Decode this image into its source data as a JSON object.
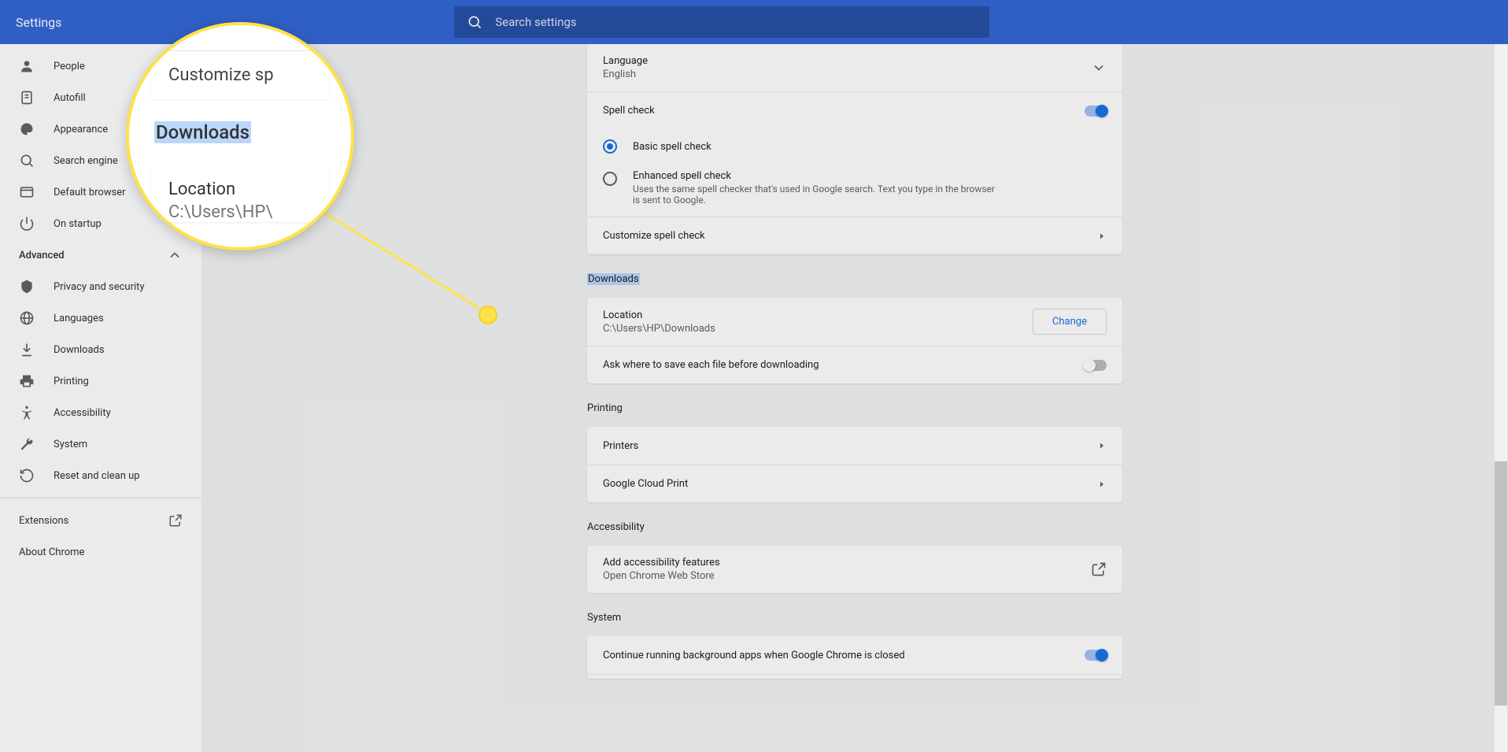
{
  "header": {
    "title": "Settings",
    "search_placeholder": "Search settings"
  },
  "sidebar": {
    "items": [
      {
        "label": "People"
      },
      {
        "label": "Autofill"
      },
      {
        "label": "Appearance"
      },
      {
        "label": "Search engine"
      },
      {
        "label": "Default browser"
      },
      {
        "label": "On startup"
      }
    ],
    "advanced_label": "Advanced",
    "advanced_items": [
      {
        "label": "Privacy and security"
      },
      {
        "label": "Languages"
      },
      {
        "label": "Downloads"
      },
      {
        "label": "Printing"
      },
      {
        "label": "Accessibility"
      },
      {
        "label": "System"
      },
      {
        "label": "Reset and clean up"
      }
    ],
    "extensions_label": "Extensions",
    "about_label": "About Chrome"
  },
  "languages": {
    "language_label": "Language",
    "language_value": "English",
    "spellcheck_label": "Spell check",
    "basic_label": "Basic spell check",
    "enhanced_label": "Enhanced spell check",
    "enhanced_desc": "Uses the same spell checker that's used in Google search. Text you type in the browser is sent to Google.",
    "customize_label": "Customize spell check"
  },
  "downloads": {
    "section_title": "Downloads",
    "location_label": "Location",
    "location_value": "C:\\Users\\HP\\Downloads",
    "change_label": "Change",
    "ask_label": "Ask where to save each file before downloading"
  },
  "printing": {
    "section_title": "Printing",
    "printers_label": "Printers",
    "cloud_label": "Google Cloud Print"
  },
  "accessibility": {
    "section_title": "Accessibility",
    "add_label": "Add accessibility features",
    "add_sub": "Open Chrome Web Store"
  },
  "system": {
    "section_title": "System",
    "bg_label": "Continue running background apps when Google Chrome is closed"
  },
  "magnifier": {
    "top_text": "Customize sp",
    "section": "Downloads",
    "loc_title": "Location",
    "loc_value": "C:\\Users\\HP\\"
  }
}
